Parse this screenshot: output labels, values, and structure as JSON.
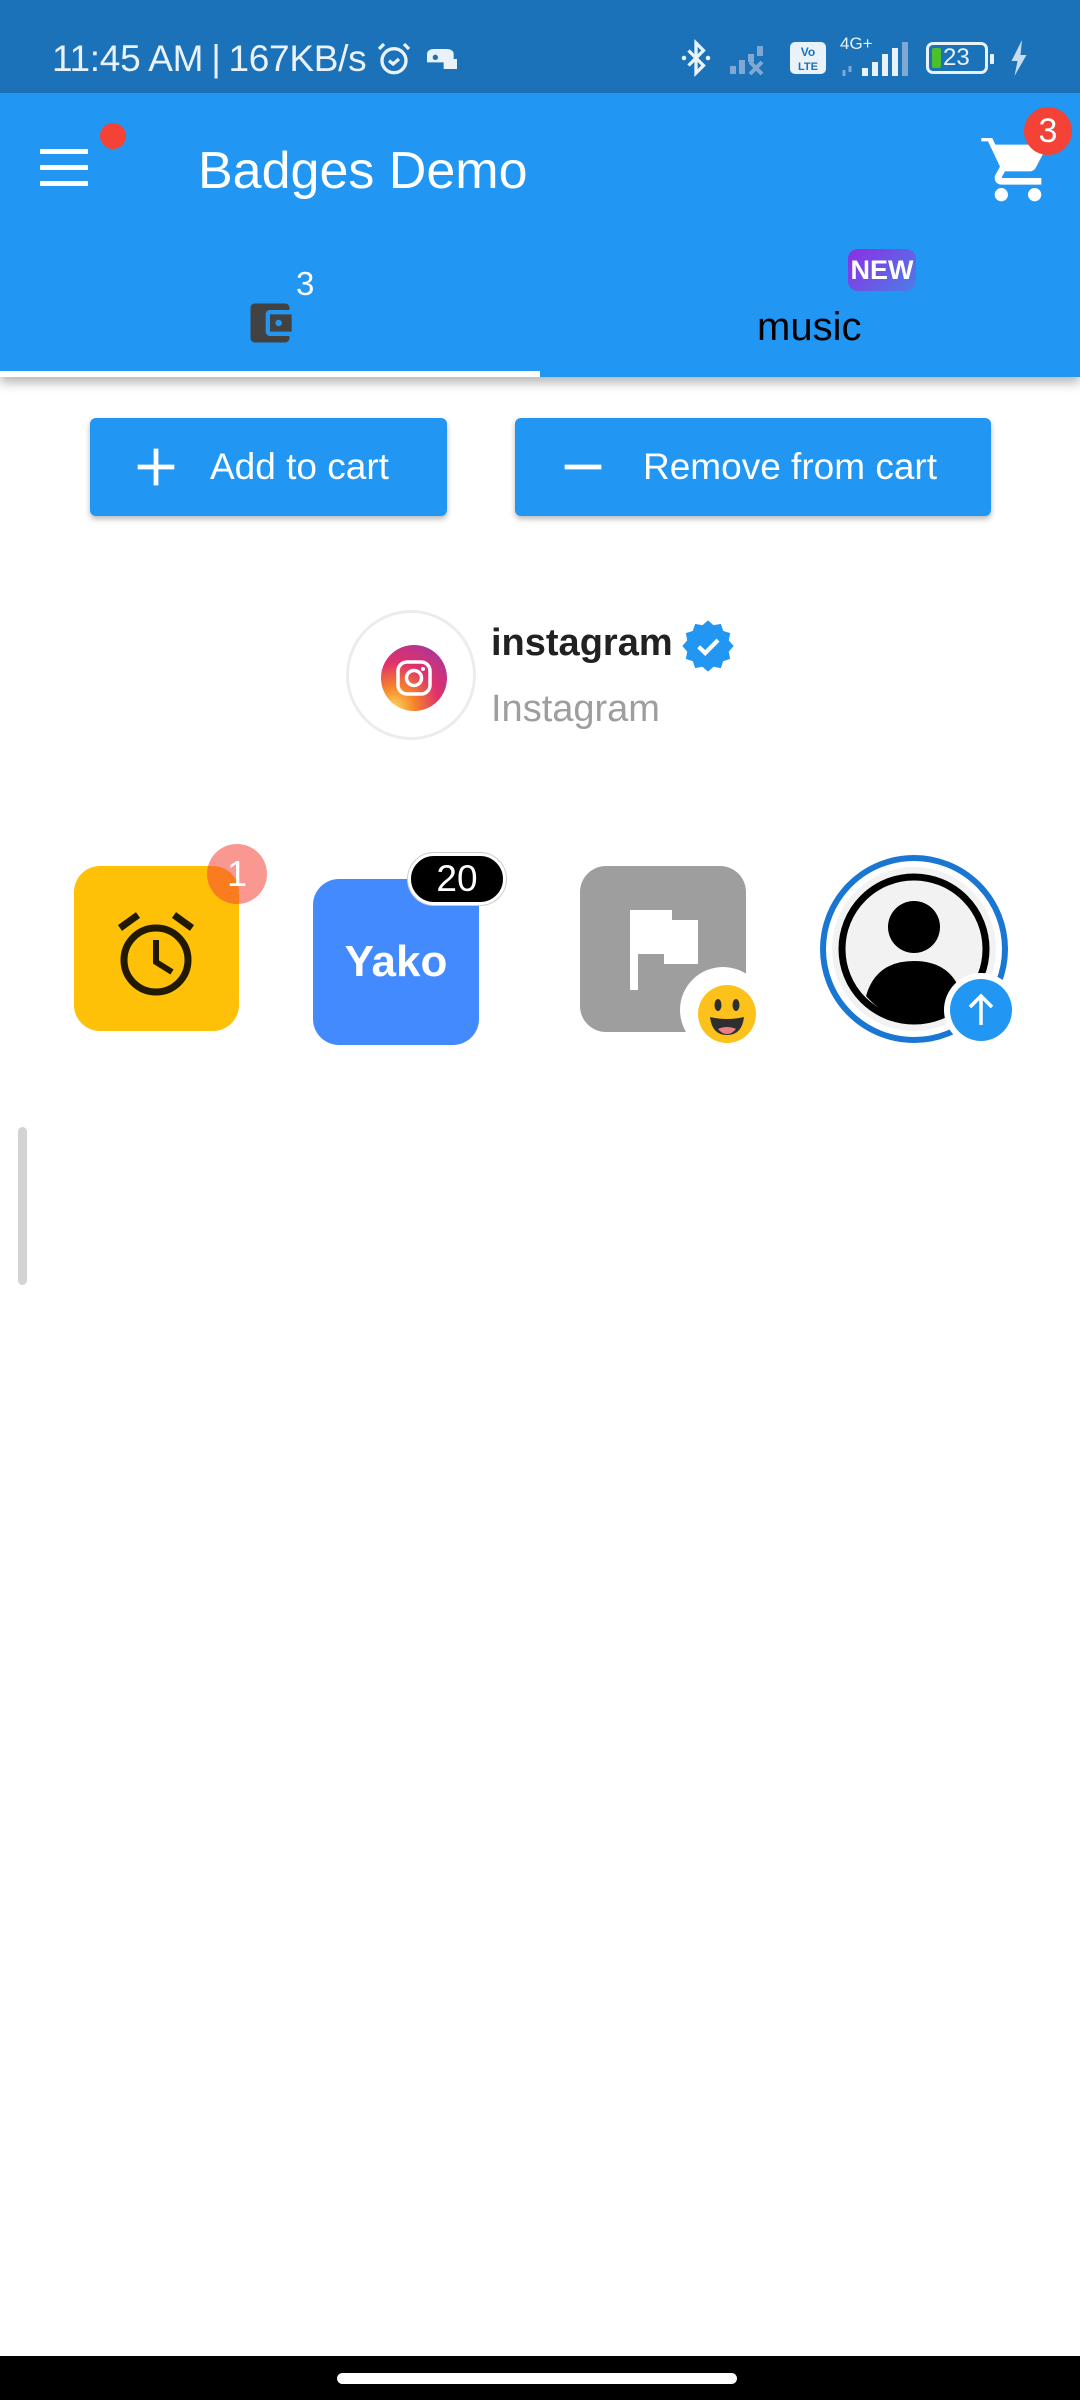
{
  "status_bar": {
    "time": "11:45 AM",
    "separator": "|",
    "net_speed": "167KB/s",
    "network_type": "4G+",
    "volte": "Vo LTE",
    "battery_percent": "23",
    "icons": [
      "alarm-icon",
      "game-icon",
      "bluetooth-icon",
      "signal-sim1-none-icon",
      "volte-icon",
      "signal-sim2-icon",
      "battery-icon",
      "charging-icon"
    ]
  },
  "app_bar": {
    "title": "Badges Demo",
    "menu_badge": "dot",
    "cart_badge_count": "3",
    "colors": {
      "primary": "#2196f3",
      "badge": "#f44336"
    }
  },
  "tabs": [
    {
      "icon": "wallet-icon",
      "badge": "3",
      "selected": true
    },
    {
      "label": "music",
      "badge": "NEW",
      "selected": false
    }
  ],
  "buttons": {
    "add_to_cart": "Add to cart",
    "remove_from_cart": "Remove from cart"
  },
  "profile_chip": {
    "name": "instagram",
    "subtitle": "Instagram",
    "verified": true
  },
  "tiles": [
    {
      "icon": "alarm-icon",
      "badge": "1",
      "color": "#ffc107"
    },
    {
      "label": "Yako",
      "badge": "20",
      "color": "#448aff"
    },
    {
      "icon": "flag-icon",
      "badge_emoji": "😃",
      "color": "#9e9e9e"
    },
    {
      "icon": "account-circle-icon",
      "badge_icon": "arrow-upward-icon",
      "ring_color": "#1976d2"
    }
  ]
}
